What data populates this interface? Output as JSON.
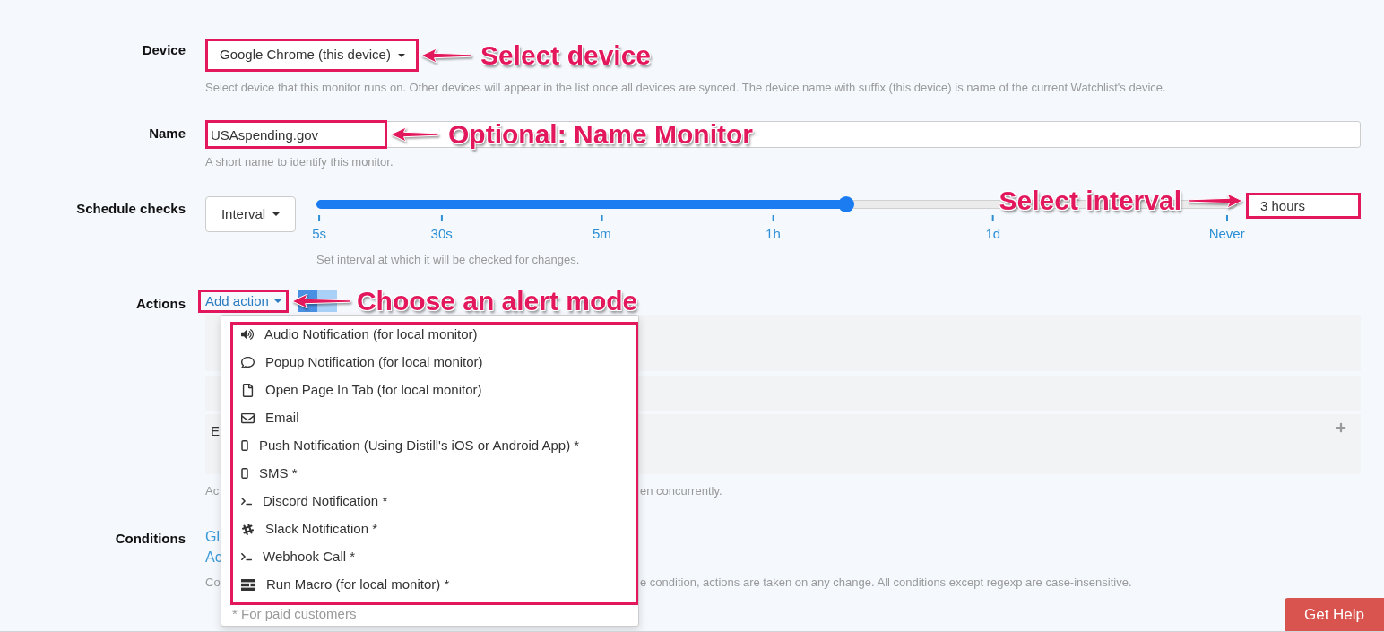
{
  "device": {
    "label": "Device",
    "value": "Google Chrome (this device)",
    "callout": "Select device",
    "help": "Select device that this monitor runs on. Other devices will appear in the list once all devices are synced. The device name with suffix (this device) is name of the current Watchlist's device."
  },
  "name": {
    "label": "Name",
    "value": "USAspending.gov",
    "callout": "Optional: Name Monitor",
    "help": "A short name to identify this monitor."
  },
  "schedule": {
    "label": "Schedule checks",
    "mode": "Interval",
    "slider": {
      "level": 0.575,
      "ticks": [
        "5s",
        "30s",
        "5m",
        "1h",
        "1d",
        "Never"
      ]
    },
    "value": "3 hours",
    "callout": "Select interval",
    "help": "Set interval at which it will be checked for changes."
  },
  "actions": {
    "label": "Actions",
    "add_link": "Add action",
    "callout": "Choose an alert mode",
    "panels": [
      {
        "kind": "blank"
      },
      {
        "kind": "blank"
      },
      {
        "kind": "entry",
        "text": "E"
      }
    ],
    "help_fragments": [
      "Ac",
      "en concurrently."
    ],
    "menu": {
      "items": [
        {
          "kind": "audio",
          "label": "Audio Notification (for local monitor)"
        },
        {
          "kind": "popup",
          "label": "Popup Notification (for local monitor)"
        },
        {
          "kind": "page",
          "label": "Open Page In Tab (for local monitor)"
        },
        {
          "kind": "email",
          "label": "Email"
        },
        {
          "kind": "push",
          "label": "Push Notification (Using Distill's iOS or Android App) *"
        },
        {
          "kind": "sms",
          "label": "SMS *"
        },
        {
          "kind": "discord",
          "label": "Discord Notification *"
        },
        {
          "kind": "slack",
          "label": "Slack Notification *"
        },
        {
          "kind": "webhook",
          "label": "Webhook Call *"
        },
        {
          "kind": "macro",
          "label": "Run Macro (for local monitor) *"
        }
      ],
      "footnote": "* For paid customers"
    }
  },
  "conditions": {
    "label": "Conditions",
    "links": [
      "Gl",
      "Ac"
    ],
    "help_fragments": [
      "Co",
      "e condition, actions are taken on any change. All conditions except regexp are case-insensitive."
    ]
  },
  "get_help": "Get Help"
}
